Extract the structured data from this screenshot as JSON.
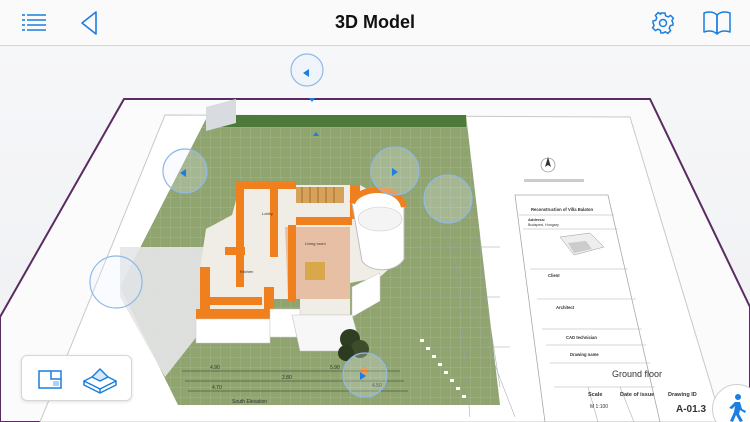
{
  "header": {
    "title": "3D Model"
  },
  "icons": {
    "menu": "menu-icon",
    "back": "back-arrow-icon",
    "settings": "gear-icon",
    "book": "book-icon",
    "plan_view": "floor-plan-view-icon",
    "model_view": "3d-model-view-icon",
    "walk": "walk-person-icon"
  },
  "colors": {
    "accent": "#1a7fe0",
    "lawn": "#8ba06a",
    "walls": "#f07f1e",
    "frame": "#5a2b62"
  },
  "sheet": {
    "project": "Reconstruction of Villa Balaton",
    "address_label": "Address:",
    "address": "Budapest, Hungary",
    "client_label": "Client",
    "architect_label": "Architect",
    "cad_label": "CAD technician",
    "drawing_name_label": "Drawing name",
    "drawing_name": "Ground floor",
    "scale_label": "Scale",
    "scale": "M 1:100",
    "date_label": "Date of issue",
    "drawing_id_label": "Drawing ID",
    "drawing_id": "A-01.3"
  },
  "plan": {
    "south_elevation": "South Elevation",
    "rooms": [
      "Kitchen",
      "Living room",
      "Lobby"
    ],
    "dimensions": [
      "4.90",
      "4.70",
      "2.80",
      "5.90",
      "4.50"
    ]
  }
}
